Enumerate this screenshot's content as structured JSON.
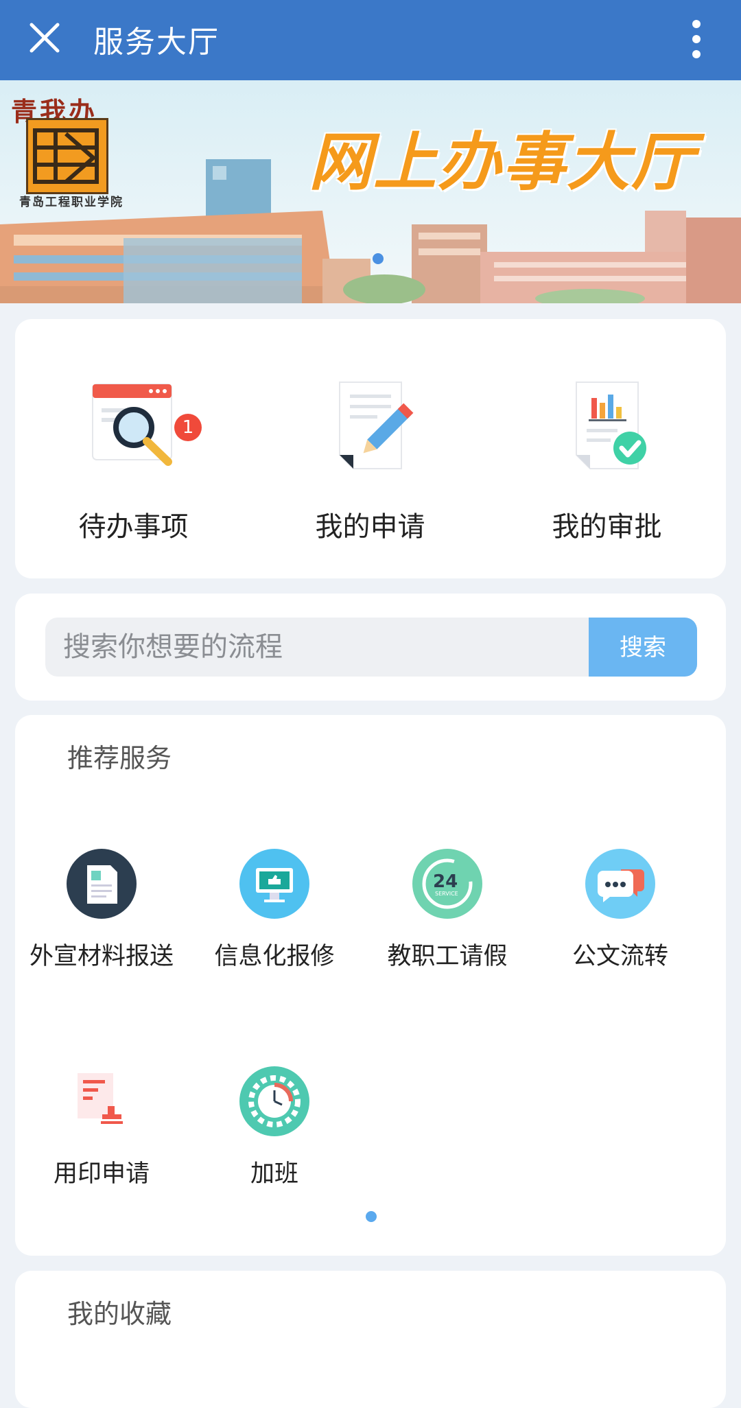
{
  "header": {
    "title": "服务大厅",
    "close_icon": "close-icon",
    "more_icon": "more-vertical-icon"
  },
  "banner": {
    "title": "网上办事大厅",
    "logo_text": "青我办",
    "logo_caption": "青岛工程职业学院"
  },
  "quick_actions": [
    {
      "label": "待办事项",
      "icon": "todo-search-icon",
      "badge": "1"
    },
    {
      "label": "我的申请",
      "icon": "application-edit-icon"
    },
    {
      "label": "我的审批",
      "icon": "approval-check-icon"
    }
  ],
  "search": {
    "placeholder": "搜索你想要的流程",
    "button_label": "搜索"
  },
  "recommended": {
    "title": "推荐服务",
    "items": [
      {
        "label": "外宣材料报送",
        "icon": "document-icon"
      },
      {
        "label": "信息化报修",
        "icon": "monitor-repair-icon"
      },
      {
        "label": "教职工请假",
        "icon": "24h-service-icon"
      },
      {
        "label": "公文流转",
        "icon": "chat-bubbles-icon"
      },
      {
        "label": "用印申请",
        "icon": "seal-stamp-icon"
      },
      {
        "label": "加班",
        "icon": "clock-gear-icon"
      }
    ]
  },
  "favorites": {
    "title": "我的收藏"
  },
  "colors": {
    "header": "#3b78c8",
    "accent": "#6ab6f2",
    "badge": "#f04a3a",
    "banner_title": "#f59a1b"
  }
}
